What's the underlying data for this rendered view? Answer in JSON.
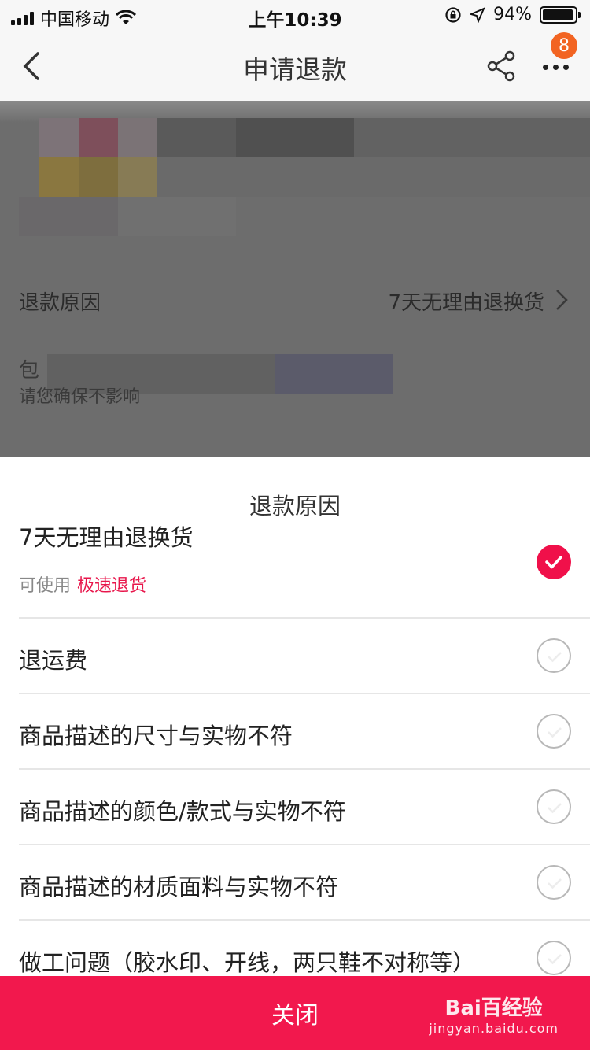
{
  "status_bar": {
    "carrier": "中国移动",
    "time": "上午10:39",
    "battery_percent": "94%",
    "battery_level": 0.94
  },
  "nav": {
    "title": "申请退款",
    "badge_count": "8",
    "icons": [
      "back-icon",
      "share-icon",
      "more-icon"
    ]
  },
  "background": {
    "reason_label": "退款原因",
    "reason_value": "7天无理由退换货",
    "obscured_line_start": "包",
    "obscured_line2": "请您确保不影响"
  },
  "sheet": {
    "title": "退款原因",
    "options": [
      {
        "label": "7天无理由退换货",
        "sub_muted": "可使用",
        "sub_accent": "极速退货",
        "checked": true
      },
      {
        "label": "退运费",
        "checked": false
      },
      {
        "label": "商品描述的尺寸与实物不符",
        "checked": false
      },
      {
        "label": "商品描述的颜色/款式与实物不符",
        "checked": false
      },
      {
        "label": "商品描述的材质面料与实物不符",
        "checked": false
      },
      {
        "label": "做工问题（胶水印、开线，两只鞋不对称等）",
        "checked": false
      }
    ],
    "close_label": "关闭"
  },
  "watermark": {
    "main": "Bai百经验",
    "sub": "jingyan.baidu.com"
  },
  "colors": {
    "accent": "#f0104a",
    "close_bar": "#f2184d",
    "badge": "#f26422"
  }
}
